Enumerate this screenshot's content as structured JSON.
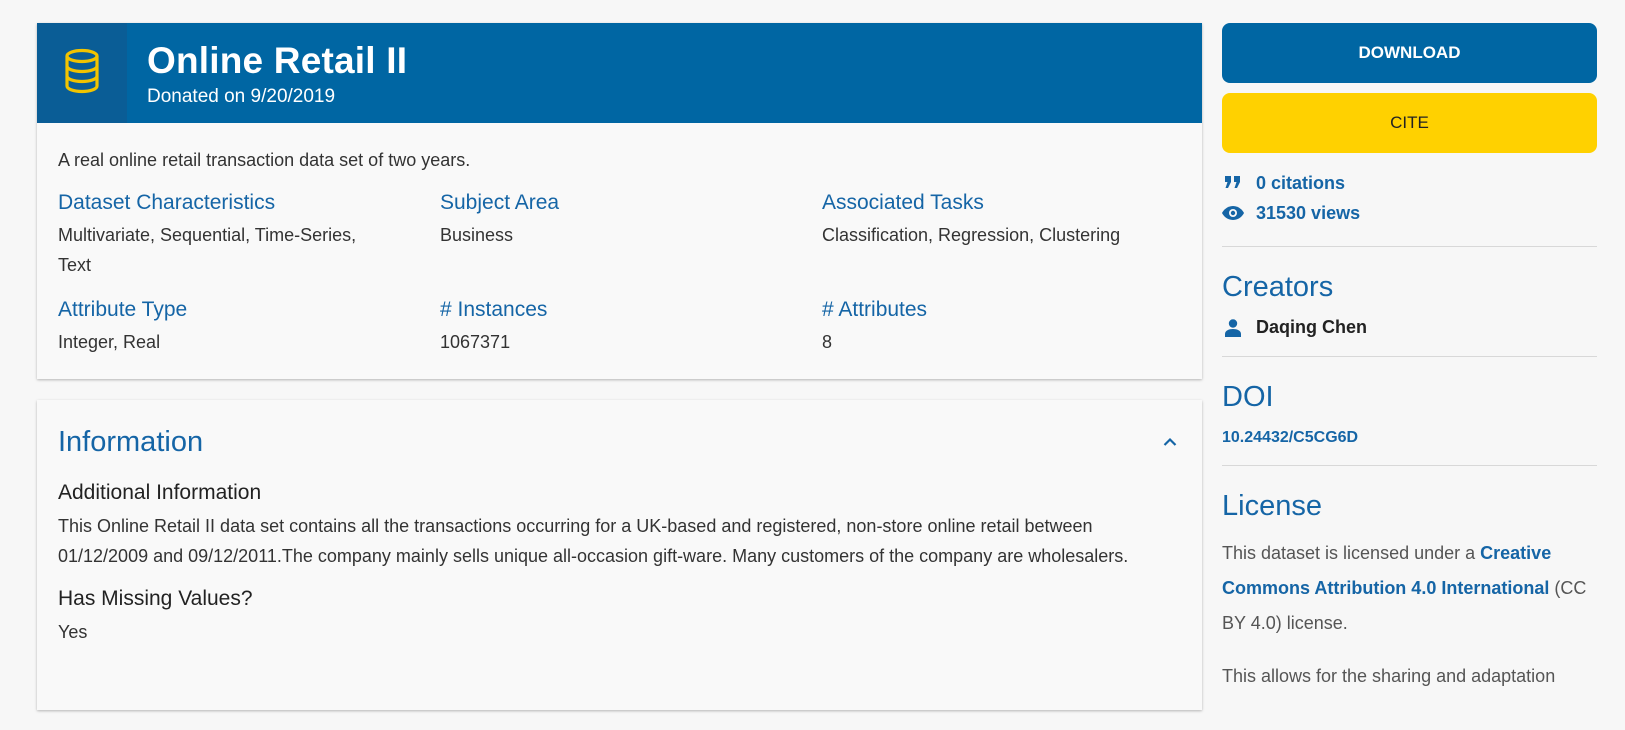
{
  "dataset": {
    "title": "Online Retail II",
    "donated": "Donated on 9/20/2019",
    "abstract": "A real online retail transaction data set of two years."
  },
  "characteristics": [
    {
      "label": "Dataset Characteristics",
      "value": "Multivariate, Sequential, Time-Series, Text"
    },
    {
      "label": "Subject Area",
      "value": "Business"
    },
    {
      "label": "Associated Tasks",
      "value": "Classification, Regression, Clustering"
    },
    {
      "label": "Attribute Type",
      "value": "Integer, Real"
    },
    {
      "label": "# Instances",
      "value": "1067371"
    },
    {
      "label": "# Attributes",
      "value": "8"
    }
  ],
  "information": {
    "title": "Information",
    "additional_heading": "Additional Information",
    "additional_text": "This Online Retail II data set contains all the transactions occurring for a UK-based and registered, non-store online retail between 01/12/2009 and 09/12/2011.The company mainly sells unique all-occasion gift-ware. Many customers of the company are wholesalers.",
    "missing_heading": "Has Missing Values?",
    "missing_value": "Yes"
  },
  "sidebar": {
    "download_label": "DOWNLOAD",
    "cite_label": "CITE",
    "citations": "0 citations",
    "views": "31530 views",
    "creators_title": "Creators",
    "creator_name": "Daqing Chen",
    "doi_title": "DOI",
    "doi": "10.24432/C5CG6D",
    "license_title": "License",
    "license_pre": "This dataset is licensed under a ",
    "license_link": "Creative Commons Attribution 4.0 International",
    "license_post": " (CC BY 4.0) license.",
    "license_more": "This allows for the sharing and adaptation"
  },
  "icons": {
    "header": "database-icon",
    "citations": "quote-icon",
    "views": "eye-icon",
    "creator": "person-icon",
    "collapse": "chevron-up-icon"
  },
  "colors": {
    "brand_blue": "#0066a3",
    "link_blue": "#1565a6",
    "cite_yellow": "#ffd100",
    "db_icon_yellow": "#f2c400"
  }
}
